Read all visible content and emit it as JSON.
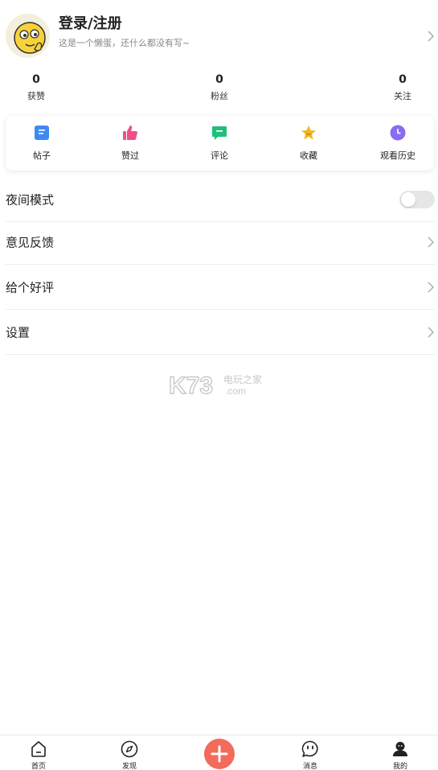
{
  "profile": {
    "name": "登录/注册",
    "description": "这是一个懒蛋，还什么都没有写~"
  },
  "stats": [
    {
      "value": "0",
      "label": "获赞"
    },
    {
      "value": "0",
      "label": "粉丝"
    },
    {
      "value": "0",
      "label": "关注"
    }
  ],
  "shortcuts": [
    {
      "label": "帖子",
      "icon": "document-icon",
      "color": "#3d8bf2"
    },
    {
      "label": "赞过",
      "icon": "thumbs-up-icon",
      "color": "#f0508a"
    },
    {
      "label": "评论",
      "icon": "comment-icon",
      "color": "#1fc07a"
    },
    {
      "label": "收藏",
      "icon": "star-icon",
      "color": "#f5b61c"
    },
    {
      "label": "观看历史",
      "icon": "clock-icon",
      "color": "#8a6cf0"
    }
  ],
  "settings": {
    "night_mode": {
      "label": "夜间模式",
      "enabled": false
    },
    "feedback": {
      "label": "意见反馈"
    },
    "rate": {
      "label": "给个好评"
    },
    "settings": {
      "label": "设置"
    }
  },
  "watermark": {
    "brand": "K73",
    "site_cn": "电玩之家",
    "site_dot": ".com"
  },
  "bottom_nav": [
    {
      "label": "首页",
      "icon": "home-icon"
    },
    {
      "label": "发现",
      "icon": "compass-icon"
    },
    {
      "label": "",
      "icon": "plus-icon"
    },
    {
      "label": "消息",
      "icon": "message-icon"
    },
    {
      "label": "我的",
      "icon": "user-icon"
    }
  ],
  "colors": {
    "accent": "#f26b5b",
    "toggle_off": "#e6e6e6"
  }
}
